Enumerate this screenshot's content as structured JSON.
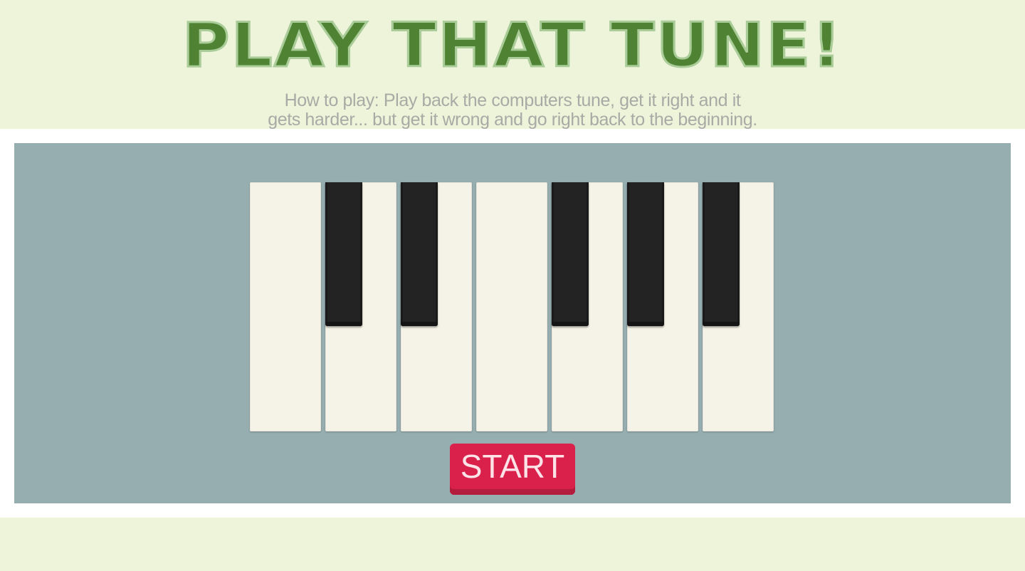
{
  "header": {
    "title": "PLAY THAT TUNE!",
    "instructions_line1": "How to play: Play back the computers tune, get it right and it",
    "instructions_line2": "gets harder... but get it wrong and go right back to the beginning."
  },
  "piano": {
    "white_keys": [
      "white-key-1",
      "white-key-2",
      "white-key-3",
      "white-key-4",
      "white-key-5",
      "white-key-6",
      "white-key-7"
    ],
    "black_keys": [
      "black-key-1",
      "black-key-2",
      "black-key-3",
      "black-key-4",
      "black-key-5"
    ]
  },
  "controls": {
    "start_label": "START"
  },
  "colors": {
    "background": "#eef4da",
    "title_green": "#4f8333",
    "board": "#97aeb1",
    "white_key": "#f5f3e7",
    "black_key": "#232323",
    "start_button": "#d9214b"
  }
}
